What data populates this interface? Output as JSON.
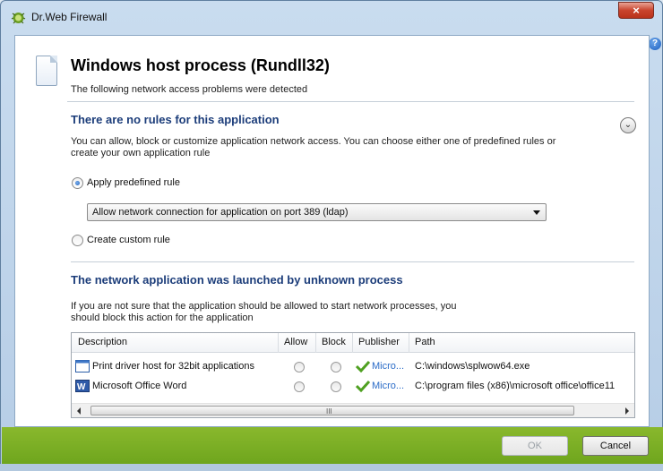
{
  "window": {
    "title": "Dr.Web Firewall",
    "close_label": "×",
    "help_label": "?"
  },
  "header": {
    "title": "Windows host process (Rundll32)",
    "subtitle": "The following network access problems were detected"
  },
  "no_rules": {
    "title": "There are no rules for this application",
    "line1": "You can allow, block or customize application network access. You can choose either one of predefined rules or",
    "line2": "create your own application rule",
    "expand_label": "⌄",
    "apply_predefined_label": "Apply predefined rule",
    "apply_predefined_checked": true,
    "dropdown_value": "Allow network connection for application on port 389 (ldap)",
    "create_custom_label": "Create custom rule",
    "create_custom_checked": false
  },
  "unknown_process": {
    "title": "The network application was launched by unknown process",
    "line1": "If you are not sure that the application should be allowed to start network processes, you",
    "line2": "should block this action for the application"
  },
  "table": {
    "columns": [
      "Description",
      "Allow",
      "Block",
      "Publisher",
      "Path"
    ],
    "rows": [
      {
        "icon": "app-window-icon",
        "description": "Print driver host for 32bit applications",
        "publisher": "Micro...",
        "path": "C:\\windows\\splwow64.exe"
      },
      {
        "icon": "word-icon",
        "description": "Microsoft Office Word",
        "publisher": "Micro...",
        "path": "C:\\program files (x86)\\microsoft office\\office11"
      }
    ],
    "scroll_grip": "III"
  },
  "footer": {
    "ok_label": "OK",
    "cancel_label": "Cancel",
    "ok_disabled": true
  },
  "colors": {
    "accent": "#1c3d7a",
    "footer_green": "#7cb027",
    "link_blue": "#2a6bc7"
  }
}
